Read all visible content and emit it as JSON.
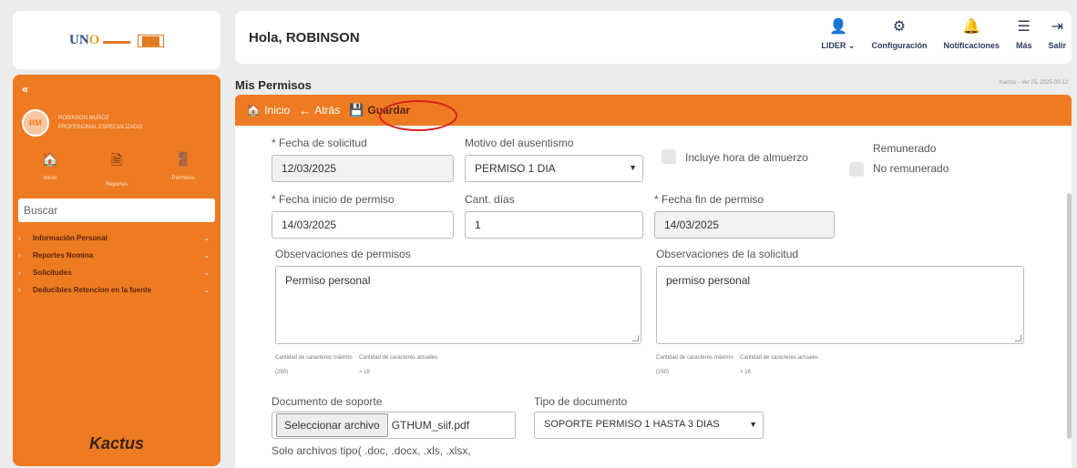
{
  "logo": {
    "part1": "UN",
    "part2": "O",
    "part3": "▬▬▬",
    "box": "███"
  },
  "sidebar": {
    "collapse": "«",
    "avatar_initials": "RM",
    "user_name": "ROBINSON MUÑOZ",
    "user_role": "PROFESIONAL ESPECIALIZADO",
    "quick": [
      {
        "icon": "home-icon",
        "glyph": "🏠",
        "label": "Inicio"
      },
      {
        "icon": "file-icon",
        "glyph": "🗎",
        "label": "Reportes"
      },
      {
        "icon": "door-icon",
        "glyph": "🚪",
        "label": "Permisos"
      }
    ],
    "search_placeholder": "Buscar",
    "nav": [
      {
        "label": "Información Personal"
      },
      {
        "label": "Reportes Nomina"
      },
      {
        "label": "Solicitudes"
      },
      {
        "label": "Deducibles Retencion en la fuente"
      }
    ],
    "brand": "Kactus"
  },
  "header": {
    "greeting": "Hola, ROBINSON",
    "buttons": [
      {
        "icon": "user-icon",
        "glyph": "👤",
        "label": "LIDER ⌄"
      },
      {
        "icon": "gear-icon",
        "glyph": "⚙",
        "label": "Configuración"
      },
      {
        "icon": "bell-icon",
        "glyph": "🔔",
        "label": "Notificaciones"
      },
      {
        "icon": "layers-icon",
        "glyph": "☰",
        "label": "Más"
      },
      {
        "icon": "logout-icon",
        "glyph": "⇥",
        "label": "Salir"
      }
    ]
  },
  "page": {
    "title": "Mis Permisos",
    "session": "Kactus - Ver 25, 2025-03-12"
  },
  "toolbar": {
    "home": "Inicio",
    "back": "Atrás",
    "save": "Guardar"
  },
  "form": {
    "fecha_solicitud": {
      "label": "* Fecha de solicitud",
      "value": "12/03/2025"
    },
    "motivo": {
      "label": "Motivo del ausentismo",
      "value": "PERMISO 1 DIA"
    },
    "almuerzo": {
      "label": "Incluye hora de almuerzo"
    },
    "remunerado": {
      "label": "Remunerado",
      "no_label": "No remunerado"
    },
    "fecha_inicio": {
      "label": "* Fecha inicio de permiso",
      "value": "14/03/2025"
    },
    "cant_dias": {
      "label": "Cant. días",
      "value": "1"
    },
    "fecha_fin": {
      "label": "* Fecha fin de permiso",
      "value": "14/03/2025"
    },
    "obs_permisos": {
      "label": "Observaciones de permisos",
      "value": "Permiso personal"
    },
    "obs_solicitud": {
      "label": "Observaciones de la solicitud",
      "value": "permiso personal"
    },
    "chars": {
      "max_label": "Cantidad de caracteres máximo",
      "max_value": "(250)",
      "cur_label": "Cantidad de caracteres actuales",
      "cur_value": "> 16"
    },
    "documento": {
      "label": "Documento de soporte",
      "button": "Seleccionar archivo",
      "filename": "GTHUM_siif.pdf",
      "hint": "Solo archivos tipo( .doc, .docx, .xls, .xlsx,"
    },
    "tipo_doc": {
      "label": "Tipo de documento",
      "value": "SOPORTE PERMISO 1 HASTA 3 DIAS"
    }
  }
}
